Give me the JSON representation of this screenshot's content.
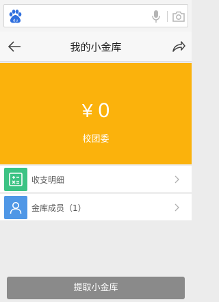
{
  "search": {
    "placeholder": ""
  },
  "nav": {
    "title": "我的小金库"
  },
  "balance": {
    "currency": "¥",
    "amount": "0",
    "owner": "校团委"
  },
  "list": {
    "items": [
      {
        "label": "收支明细",
        "icon": "ledger-icon",
        "color": "#3cc384"
      },
      {
        "label": "金库成员（1）",
        "icon": "user-icon",
        "color": "#4f97e6"
      }
    ]
  },
  "footer": {
    "withdraw_label": "提取小金库"
  },
  "colors": {
    "accent": "#fbb20c",
    "button": "#8a8a8a"
  }
}
